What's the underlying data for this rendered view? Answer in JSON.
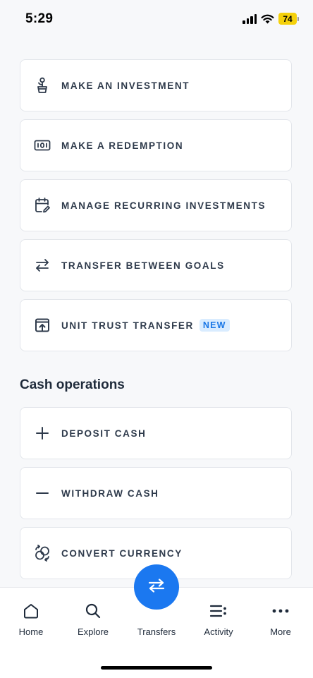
{
  "status_bar": {
    "time": "5:29",
    "battery": "74"
  },
  "actions": [
    {
      "label": "MAKE AN INVESTMENT",
      "icon": "plant-pot-icon"
    },
    {
      "label": "MAKE A REDEMPTION",
      "icon": "cash-note-icon"
    },
    {
      "label": "MANAGE RECURRING INVESTMENTS",
      "icon": "calendar-edit-icon"
    },
    {
      "label": "TRANSFER BETWEEN GOALS",
      "icon": "swap-arrows-icon"
    },
    {
      "label": "UNIT TRUST TRANSFER",
      "icon": "upload-box-icon",
      "badge": "NEW"
    }
  ],
  "cash_operations": {
    "title": "Cash operations",
    "items": [
      {
        "label": "DEPOSIT CASH",
        "icon": "plus-icon"
      },
      {
        "label": "WITHDRAW CASH",
        "icon": "minus-icon"
      },
      {
        "label": "CONVERT CURRENCY",
        "icon": "currency-exchange-icon"
      }
    ]
  },
  "tab_bar": {
    "tabs": [
      {
        "label": "Home",
        "icon": "home-icon"
      },
      {
        "label": "Explore",
        "icon": "search-icon"
      },
      {
        "label": "Transfers",
        "icon": "transfer-icon"
      },
      {
        "label": "Activity",
        "icon": "list-icon"
      },
      {
        "label": "More",
        "icon": "more-dots-icon"
      }
    ]
  },
  "colors": {
    "accent": "#1B78F0",
    "badge_bg": "#D9ECFF",
    "battery": "#F5D10B",
    "background": "#F7F8FA"
  }
}
